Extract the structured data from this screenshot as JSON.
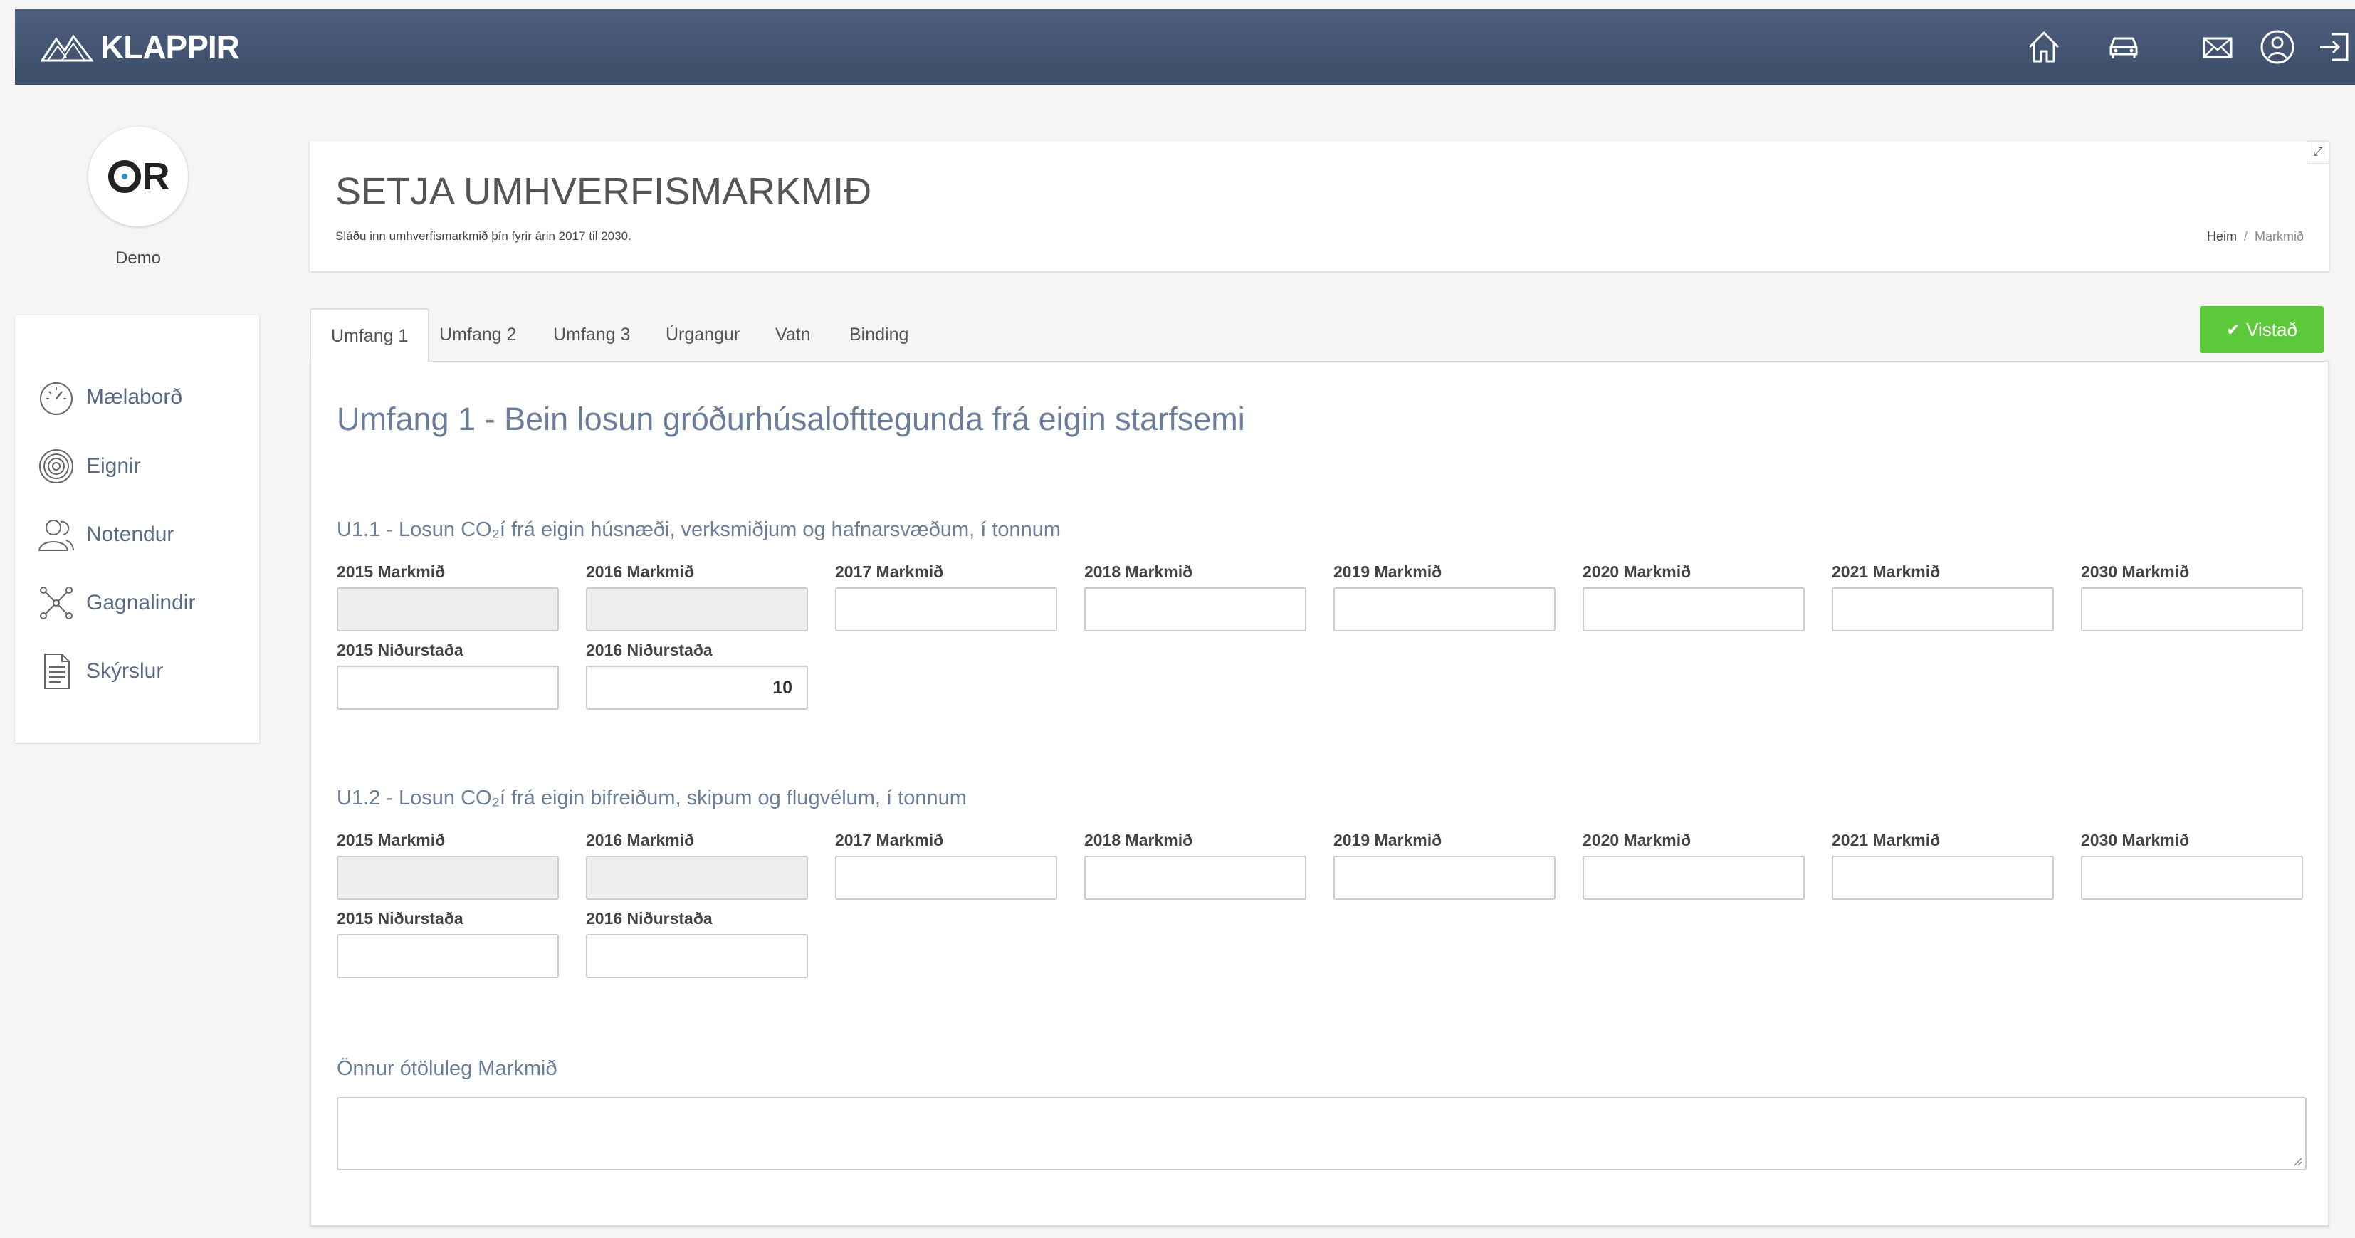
{
  "app": {
    "brand": "KLAPPIR",
    "colors": {
      "topbar": "#4d5f7d",
      "accent": "#5cc93b",
      "heading": "#6a7d99"
    }
  },
  "topnav": {
    "icons": [
      "home-icon",
      "car-icon",
      "mail-icon",
      "user-icon",
      "logout-icon"
    ]
  },
  "profile": {
    "logo_text": "R",
    "name": "Demo"
  },
  "sidebar": {
    "items": [
      {
        "label": "Mælaborð",
        "icon": "dashboard-icon"
      },
      {
        "label": "Eignir",
        "icon": "assets-icon"
      },
      {
        "label": "Notendur",
        "icon": "users-icon"
      },
      {
        "label": "Gagnalindir",
        "icon": "data-sources-icon"
      },
      {
        "label": "Skýrslur",
        "icon": "reports-icon"
      }
    ]
  },
  "header": {
    "title": "SETJA UMHVERFISMARKMIÐ",
    "subtitle": "Sláðu inn umhverfismarkmið þín fyrir árin 2017 til 2030.",
    "breadcrumb": {
      "home": "Heim",
      "separator": "/",
      "current": "Markmið"
    },
    "expand_symbol": "⤢"
  },
  "tabs": [
    {
      "label": "Umfang 1",
      "active": true
    },
    {
      "label": "Umfang 2",
      "active": false
    },
    {
      "label": "Umfang 3",
      "active": false
    },
    {
      "label": "Úrgangur",
      "active": false
    },
    {
      "label": "Vatn",
      "active": false
    },
    {
      "label": "Binding",
      "active": false
    }
  ],
  "save_button": {
    "label": "Vistað",
    "check": "✔"
  },
  "main": {
    "section_title": "Umfang 1 - Bein losun gróðurhúsalofttegunda frá eigin starfsemi",
    "groups": [
      {
        "title": "U1.1 - Losun CO₂í frá eigin húsnæði, verksmiðjum og hafnarsvæðum, í tonnum",
        "targets": [
          {
            "label": "2015 Markmið",
            "value": "",
            "disabled": true
          },
          {
            "label": "2016 Markmið",
            "value": "",
            "disabled": true
          },
          {
            "label": "2017 Markmið",
            "value": "",
            "disabled": false
          },
          {
            "label": "2018 Markmið",
            "value": "",
            "disabled": false
          },
          {
            "label": "2019 Markmið",
            "value": "",
            "disabled": false
          },
          {
            "label": "2020 Markmið",
            "value": "",
            "disabled": false
          },
          {
            "label": "2021 Markmið",
            "value": "",
            "disabled": false
          },
          {
            "label": "2030 Markmið",
            "value": "",
            "disabled": false
          }
        ],
        "results": [
          {
            "label": "2015 Niðurstaða",
            "value": ""
          },
          {
            "label": "2016 Niðurstaða",
            "value": "10"
          }
        ]
      },
      {
        "title": "U1.2 - Losun CO₂í frá eigin bifreiðum, skipum og flugvélum, í tonnum",
        "targets": [
          {
            "label": "2015 Markmið",
            "value": "",
            "disabled": true
          },
          {
            "label": "2016 Markmið",
            "value": "",
            "disabled": true
          },
          {
            "label": "2017 Markmið",
            "value": "",
            "disabled": false
          },
          {
            "label": "2018 Markmið",
            "value": "",
            "disabled": false
          },
          {
            "label": "2019 Markmið",
            "value": "",
            "disabled": false
          },
          {
            "label": "2020 Markmið",
            "value": "",
            "disabled": false
          },
          {
            "label": "2021 Markmið",
            "value": "",
            "disabled": false
          },
          {
            "label": "2030 Markmið",
            "value": "",
            "disabled": false
          }
        ],
        "results": [
          {
            "label": "2015 Niðurstaða",
            "value": ""
          },
          {
            "label": "2016 Niðurstaða",
            "value": ""
          }
        ]
      }
    ],
    "other_goals_label": "Önnur ótöluleg Markmið",
    "other_goals_value": ""
  }
}
